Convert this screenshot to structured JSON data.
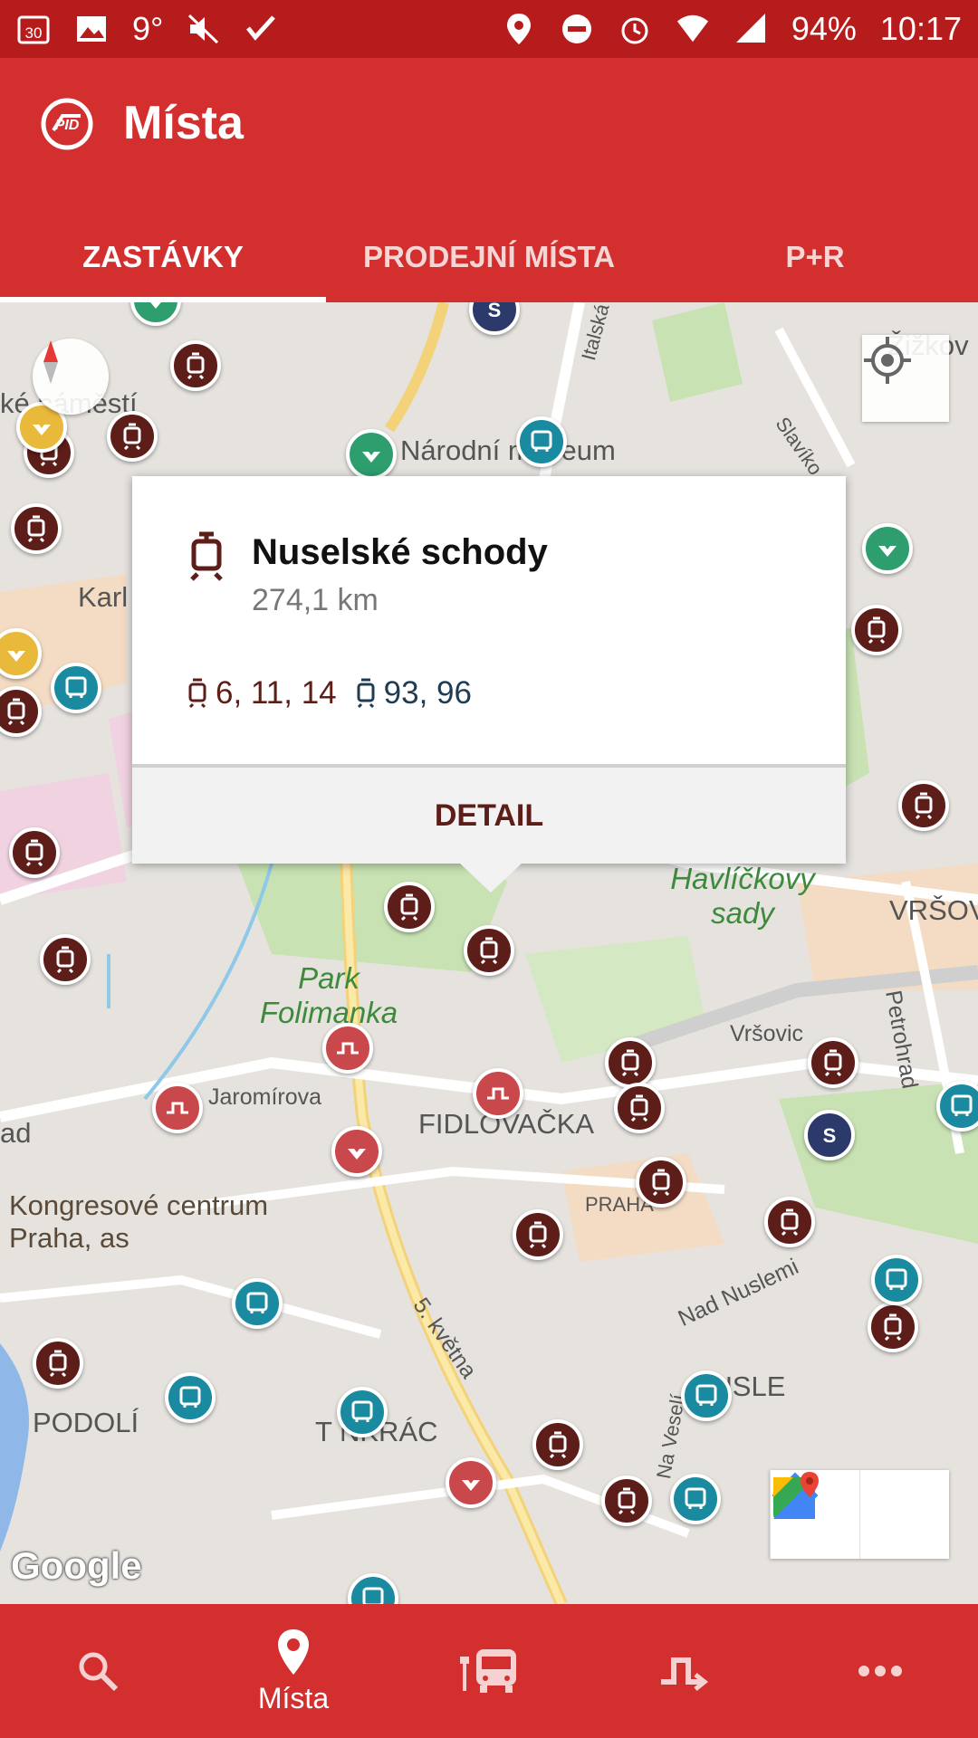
{
  "status_bar": {
    "left_icons": [
      "calendar-icon",
      "image-icon",
      "weather-icon",
      "mute-icon",
      "checklist-icon"
    ],
    "calendar_day": "30",
    "temperature": "9°",
    "battery": "94%",
    "time": "10:17"
  },
  "app_bar": {
    "title": "Místa",
    "tabs": [
      {
        "label": "ZASTÁVKY",
        "active": true
      },
      {
        "label": "PRODEJNÍ MÍSTA",
        "active": false
      },
      {
        "label": "P+R",
        "active": false
      }
    ]
  },
  "map": {
    "labels": {
      "namesti": "ké náměstí",
      "narodni_museum": "Národní muzeum",
      "karl": "Karl",
      "havlickovy_sady": "Havlíčkovy sady",
      "vrsov": "VRŠOV",
      "park_folimanka": "Park Folimanka",
      "jaromirova": "Jaromírova",
      "fidlovacka": "FIDLOVAČKA",
      "kongresove": "Kongresové centrum Praha, as",
      "podoli": "PODOLÍ",
      "pankrac": "T NKRÁC",
      "nusle": "NUSLE",
      "nad_nuslemi": "Nad Nuslemi",
      "petrohrad": "Petrohrad",
      "vrsovic": "Vršovic",
      "five_kvetna": "5. května",
      "italska": "Italská",
      "slavikova": "Slavíko",
      "zizkov": "Žižkov",
      "na_vesel": "Na Veselí",
      "praha": "PRAHA",
      "ad": "ad",
      "google": "Google"
    },
    "colors": {
      "tram": "#5d1d18",
      "bus": "#1a8aa0",
      "metro_c": "#c9484b",
      "metro_a": "#2e9e6e",
      "metro_b": "#e8b93a",
      "train": "#2b3a6b"
    }
  },
  "popup": {
    "stop_name": "Nuselské schody",
    "distance": "274,1 km",
    "tram_lines": "6, 11, 14",
    "night_tram_lines": "93, 96",
    "detail_button": "DETAIL"
  },
  "bottom_nav": {
    "items": [
      {
        "icon": "search-icon",
        "label": ""
      },
      {
        "icon": "location-pin-icon",
        "label": "Místa"
      },
      {
        "icon": "departures-icon",
        "label": ""
      },
      {
        "icon": "route-icon",
        "label": ""
      },
      {
        "icon": "more-icon",
        "label": ""
      }
    ]
  }
}
